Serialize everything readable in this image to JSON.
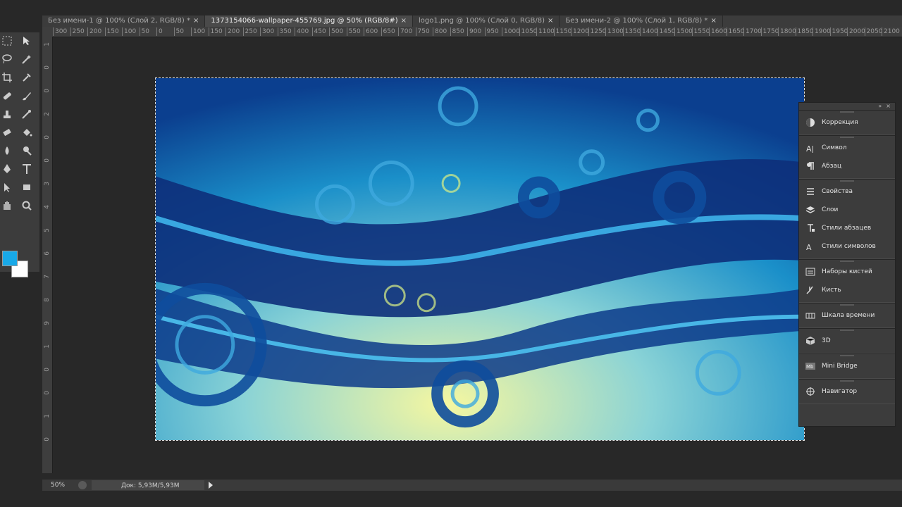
{
  "tabs": [
    {
      "label": "Без имени-1 @ 100% (Слой 2, RGB/8) *",
      "active": false
    },
    {
      "label": "1373154066-wallpaper-455769.jpg @ 50% (RGB/8#)",
      "active": true
    },
    {
      "label": "logo1.png @ 100% (Слой 0, RGB/8)",
      "active": false
    },
    {
      "label": "Без имени-2 @ 100% (Слой 1, RGB/8) *",
      "active": false
    }
  ],
  "tab_close": "×",
  "ruler": {
    "horizontal": [
      "300",
      "250",
      "200",
      "150",
      "100",
      "50",
      "0",
      "50",
      "100",
      "150",
      "200",
      "250",
      "300",
      "350",
      "400",
      "450",
      "500",
      "550",
      "600",
      "650",
      "700",
      "750",
      "800",
      "850",
      "900",
      "950",
      "1000",
      "1050",
      "1100",
      "1150",
      "1200",
      "1250",
      "1300",
      "1350",
      "1400",
      "1450",
      "1500",
      "1550",
      "1600",
      "1650",
      "1700",
      "1750",
      "1800",
      "1850",
      "1900",
      "1950",
      "2000",
      "2050",
      "2100"
    ],
    "vertical": [
      "1",
      "0",
      "0",
      "2",
      "0",
      "0",
      "3",
      "4",
      "5",
      "6",
      "7",
      "8",
      "9",
      "1",
      "0",
      "0",
      "1",
      "0"
    ]
  },
  "tools": [
    {
      "name": "marquee-tool",
      "icon": "marquee-icon"
    },
    {
      "name": "move-tool",
      "icon": "move-icon"
    },
    {
      "name": "lasso-tool",
      "icon": "lasso-icon"
    },
    {
      "name": "quick-select-tool",
      "icon": "wand-icon"
    },
    {
      "name": "crop-tool",
      "icon": "crop-icon"
    },
    {
      "name": "eyedropper-tool",
      "icon": "eyedropper-icon"
    },
    {
      "name": "healing-tool",
      "icon": "bandage-icon"
    },
    {
      "name": "brush-tool",
      "icon": "brush-icon"
    },
    {
      "name": "stamp-tool",
      "icon": "stamp-icon"
    },
    {
      "name": "history-brush-tool",
      "icon": "history-brush-icon"
    },
    {
      "name": "eraser-tool",
      "icon": "eraser-icon"
    },
    {
      "name": "bucket-tool",
      "icon": "bucket-icon"
    },
    {
      "name": "blur-tool",
      "icon": "blur-icon"
    },
    {
      "name": "dodge-tool",
      "icon": "dodge-icon"
    },
    {
      "name": "pen-tool",
      "icon": "pen-icon"
    },
    {
      "name": "type-tool",
      "icon": "type-icon"
    },
    {
      "name": "path-select-tool",
      "icon": "arrow-icon"
    },
    {
      "name": "shape-tool",
      "icon": "rectangle-icon"
    },
    {
      "name": "hand-tool",
      "icon": "hand-icon"
    },
    {
      "name": "zoom-tool",
      "icon": "zoom-icon"
    }
  ],
  "colors": {
    "foreground": "#18a9e8",
    "background": "#ffffff",
    "type_label": "T"
  },
  "panel": {
    "groups": [
      [
        {
          "label": "Коррекция",
          "icon": "adjustments-icon"
        }
      ],
      [
        {
          "label": "Символ",
          "icon": "character-icon"
        },
        {
          "label": "Абзац",
          "icon": "paragraph-icon"
        }
      ],
      [
        {
          "label": "Свойства",
          "icon": "properties-icon"
        },
        {
          "label": "Слои",
          "icon": "layers-icon"
        },
        {
          "label": "Стили абзацев",
          "icon": "paragraph-styles-icon"
        },
        {
          "label": "Стили символов",
          "icon": "character-styles-icon"
        }
      ],
      [
        {
          "label": "Наборы кистей",
          "icon": "brush-presets-icon"
        },
        {
          "label": "Кисть",
          "icon": "brush-panel-icon"
        }
      ],
      [
        {
          "label": "Шкала времени",
          "icon": "timeline-icon"
        }
      ],
      [
        {
          "label": "3D",
          "icon": "cube-icon"
        }
      ],
      [
        {
          "label": "Mini Bridge",
          "icon": "mini-bridge-icon"
        }
      ],
      [
        {
          "label": "Навигатор",
          "icon": "navigator-icon"
        }
      ]
    ]
  },
  "status": {
    "zoom": "50%",
    "doc": "Док: 5,93M/5,93M"
  }
}
